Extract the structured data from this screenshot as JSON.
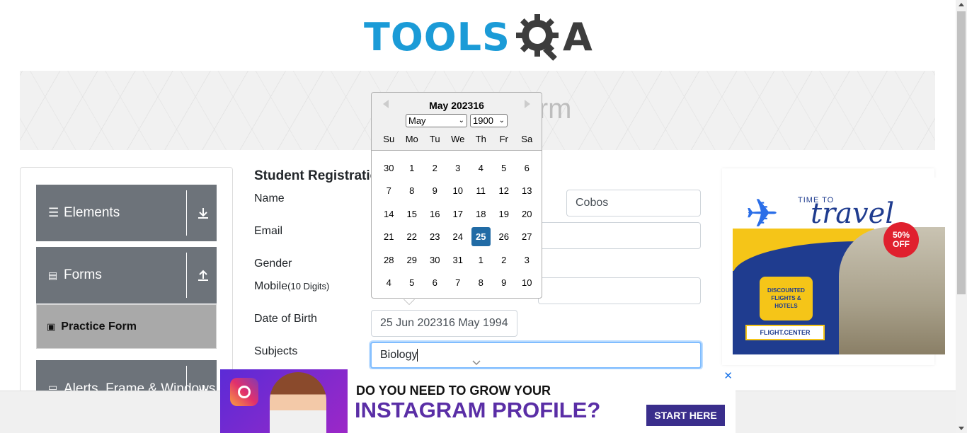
{
  "logo": {
    "part1": "TOOLS",
    "part2": "A"
  },
  "banner": {
    "title": "Practice Form"
  },
  "sidebar": {
    "groups": [
      {
        "label": "Elements",
        "icon": "hamburger-icon",
        "arrow": "download-arrow-icon"
      },
      {
        "label": "Forms",
        "icon": "document-icon",
        "arrow": "upload-arrow-icon"
      },
      {
        "label": "Alerts, Frame & Windows",
        "icon": "window-icon",
        "arrow": "download-arrow-icon"
      }
    ],
    "active_item": {
      "label": "Practice Form",
      "icon": "form-icon"
    }
  },
  "form": {
    "title": "Student Registration Form",
    "name_label": "Name",
    "last_name_value": "Cobos",
    "email_label": "Email",
    "gender_label": "Gender",
    "mobile_label": "Mobile",
    "mobile_hint": "(10 Digits)",
    "dob_label": "Date of Birth",
    "dob_value": "25 Jun 202316 May 1994",
    "subjects_label": "Subjects",
    "subjects_value": "Biology"
  },
  "datepicker": {
    "header": "May 202316",
    "month_select": "May",
    "year_select": "1900",
    "weekdays": [
      "Su",
      "Mo",
      "Tu",
      "We",
      "Th",
      "Fr",
      "Sa"
    ],
    "weeks": [
      [
        "30",
        "1",
        "2",
        "3",
        "4",
        "5",
        "6"
      ],
      [
        "7",
        "8",
        "9",
        "10",
        "11",
        "12",
        "13"
      ],
      [
        "14",
        "15",
        "16",
        "17",
        "18",
        "19",
        "20"
      ],
      [
        "21",
        "22",
        "23",
        "24",
        "25",
        "26",
        "27"
      ],
      [
        "28",
        "29",
        "30",
        "31",
        "1",
        "2",
        "3"
      ],
      [
        "4",
        "5",
        "6",
        "7",
        "8",
        "9",
        "10"
      ]
    ],
    "selected_day": "25"
  },
  "ad_right": {
    "time_to": "TIME TO",
    "travel": "travel",
    "discount": "50% OFF",
    "box_text": "DISCOUNTED FLIGHTS & HOTELS",
    "brand": "FLIGHT.CENTER",
    "close": "✕"
  },
  "ad_bottom": {
    "line1": "DO YOU NEED TO GROW YOUR",
    "line2": "INSTAGRAM PROFILE?",
    "cta": "START HERE",
    "close": "✕"
  },
  "colors": {
    "brand_blue": "#1b9bd7",
    "sidebar_gray": "#6d737a",
    "selected_day": "#216ba5"
  }
}
